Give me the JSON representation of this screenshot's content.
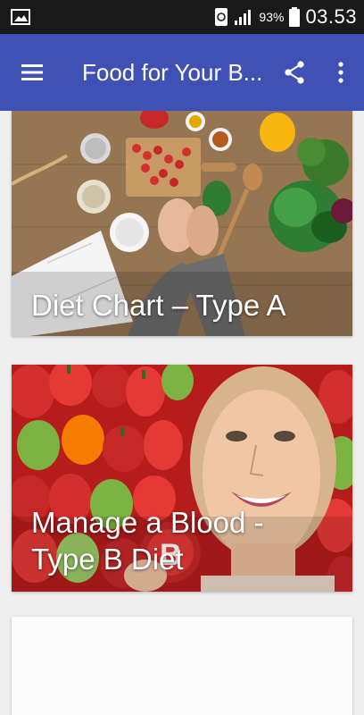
{
  "status_bar": {
    "battery_pct": "93%",
    "time": "03.53",
    "icons": [
      "image-icon",
      "sync-icon",
      "signal-icon",
      "battery-icon"
    ]
  },
  "app_bar": {
    "title": "Food for Your B...",
    "menu_icon": "hamburger-menu-icon",
    "share_icon": "share-icon",
    "overflow_icon": "more-vert-icon",
    "color": "#3f51b5"
  },
  "cards": [
    {
      "title": "Diet Chart – Type A"
    },
    {
      "title": "Manage a Blood - Type B Diet"
    }
  ]
}
